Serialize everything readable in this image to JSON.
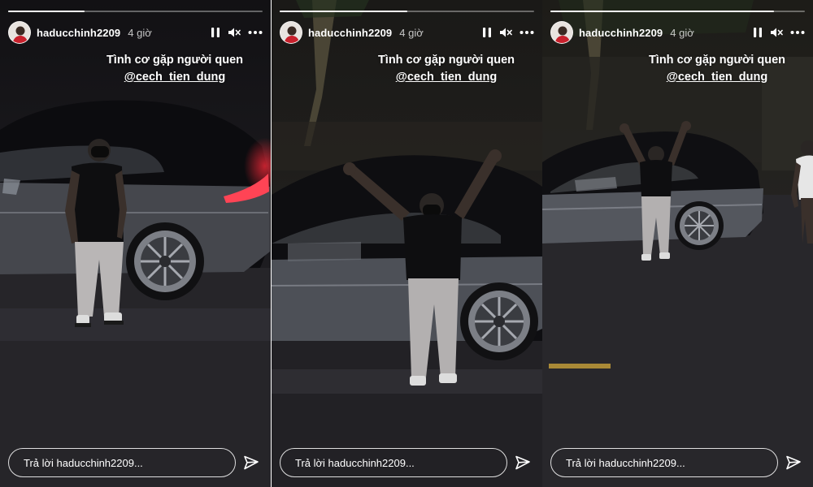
{
  "stories": [
    {
      "username": "haducchinh2209",
      "time": "4 giờ",
      "progress": 0.3,
      "caption_line1": "Tình cơ gặp người quen",
      "caption_mention": "@cech_tien_dung",
      "reply_placeholder": "Trả lời haducchinh2209..."
    },
    {
      "username": "haducchinh2209",
      "time": "4 giờ",
      "progress": 0.5,
      "caption_line1": "Tình cơ gặp người quen",
      "caption_mention": "@cech_tien_dung",
      "reply_placeholder": "Trả lời haducchinh2209..."
    },
    {
      "username": "haducchinh2209",
      "time": "4 giờ",
      "progress": 0.88,
      "caption_line1": "Tình cơ gặp người quen",
      "caption_mention": "@cech_tien_dung",
      "reply_placeholder": "Trả lời haducchinh2209..."
    }
  ],
  "icons": {
    "pause": "pause-icon",
    "mute": "speaker-muted-icon",
    "more": "more-options-icon",
    "send": "send-icon"
  },
  "colors": {
    "background": "#1b1a1d",
    "text": "#ffffff",
    "brake_light": "#ff2a3a",
    "road_line": "#c9a23a"
  }
}
